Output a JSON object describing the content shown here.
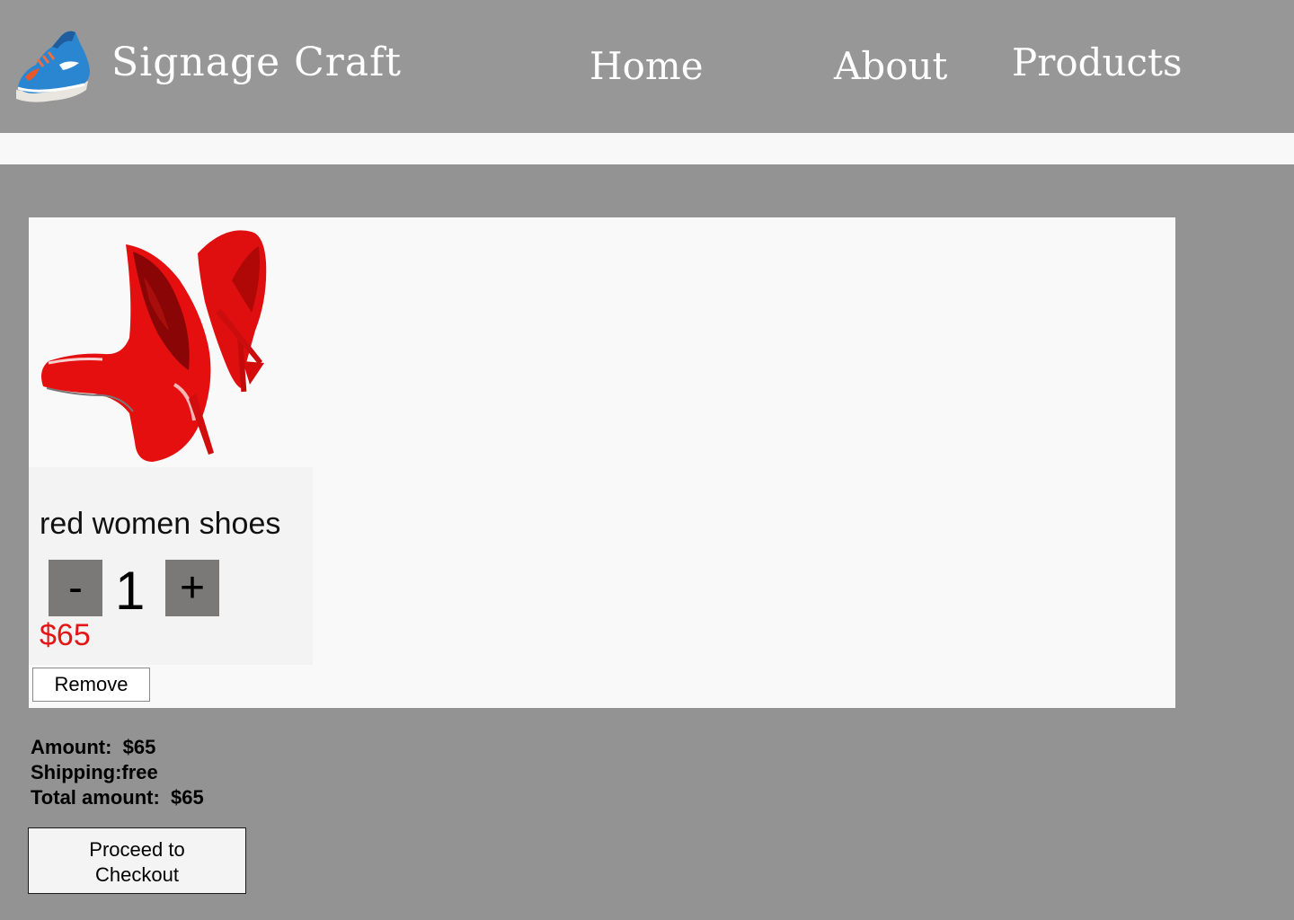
{
  "header": {
    "logo_icon": "sneaker-icon",
    "brand": "Signage Craft",
    "nav": {
      "home": "Home",
      "about": "About",
      "products": "Products"
    }
  },
  "cart": {
    "items": [
      {
        "image_icon": "red-high-heels-image",
        "name": "red women shoes",
        "decrement_label": "-",
        "quantity": "1",
        "increment_label": "+",
        "price": "$65",
        "remove_label": "Remove"
      }
    ]
  },
  "summary": {
    "amount": "Amount:  $65",
    "shipping": "Shipping:free",
    "total": "Total amount:  $65"
  },
  "checkout": {
    "label": "Proceed to Checkout"
  },
  "colors": {
    "background": "#939393",
    "header": "#979797",
    "panel": "#f9f9f9",
    "price": "#e31616",
    "qty_button": "#7b7878"
  }
}
